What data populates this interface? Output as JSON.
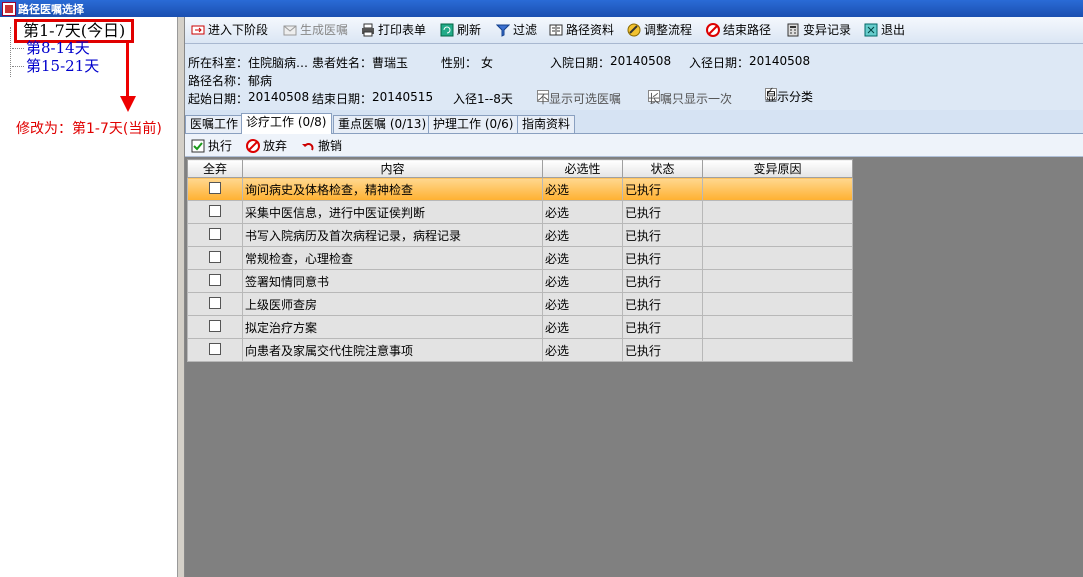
{
  "window": {
    "title": "路径医嘱选择"
  },
  "tree": {
    "items": [
      {
        "label": "第1-7天(今日)",
        "selected": true
      },
      {
        "label": "第8-14天",
        "selected": false
      },
      {
        "label": "第15-21天",
        "selected": false
      }
    ]
  },
  "annotation": {
    "text": "修改为：第1-7天(当前)",
    "color": "#e00000"
  },
  "toolbar": {
    "next_stage": "进入下阶段",
    "generate": "生成医嘱",
    "print": "打印表单",
    "refresh": "刷新",
    "filter": "过滤",
    "path_info": "路径资料",
    "adjust": "调整流程",
    "end_path": "结束路径",
    "variance": "变异记录",
    "exit": "退出"
  },
  "info": {
    "dept_label": "所在科室：",
    "dept_value": "住院脑病…",
    "patient_label": "患者姓名：",
    "patient_value": "曹瑞玉",
    "gender_label": "性别：",
    "gender_value": "女",
    "admit_label": "入院日期：",
    "admit_value": "20140508",
    "enter_label": "入径日期：",
    "enter_value": "20140508",
    "path_label": "路径名称：",
    "path_value": "郁病",
    "start_label": "起始日期：",
    "start_value": "20140508",
    "end_label": "结束日期：",
    "end_value": "20140515",
    "range": "入径1--8天",
    "opt_hide": "不显示可选医嘱",
    "opt_long": "长嘱只显示一次",
    "opt_cat": "显示分类"
  },
  "tabs": [
    {
      "label": "医嘱工作"
    },
    {
      "label": "诊疗工作 (0/8)"
    },
    {
      "label": "重点医嘱 (0/13)"
    },
    {
      "label": "护理工作 (0/6)"
    },
    {
      "label": "指南资料"
    }
  ],
  "subbar": {
    "execute": "执行",
    "abandon": "放弃",
    "undo": "撤销"
  },
  "grid": {
    "headers": [
      "全弃",
      "内容",
      "必选性",
      "状态",
      "变异原因"
    ],
    "rows": [
      {
        "content": "询问病史及体格检查，精神检查",
        "required": "必选",
        "status": "已执行",
        "reason": ""
      },
      {
        "content": "采集中医信息，进行中医证侯判断",
        "required": "必选",
        "status": "已执行",
        "reason": ""
      },
      {
        "content": "书写入院病历及首次病程记录，病程记录",
        "required": "必选",
        "status": "已执行",
        "reason": ""
      },
      {
        "content": "常规检查，心理检查",
        "required": "必选",
        "status": "已执行",
        "reason": ""
      },
      {
        "content": "签署知情同意书",
        "required": "必选",
        "status": "已执行",
        "reason": ""
      },
      {
        "content": "上级医师查房",
        "required": "必选",
        "status": "已执行",
        "reason": ""
      },
      {
        "content": "拟定治疗方案",
        "required": "必选",
        "status": "已执行",
        "reason": ""
      },
      {
        "content": "向患者及家属交代住院注意事项",
        "required": "必选",
        "status": "已执行",
        "reason": ""
      }
    ]
  }
}
